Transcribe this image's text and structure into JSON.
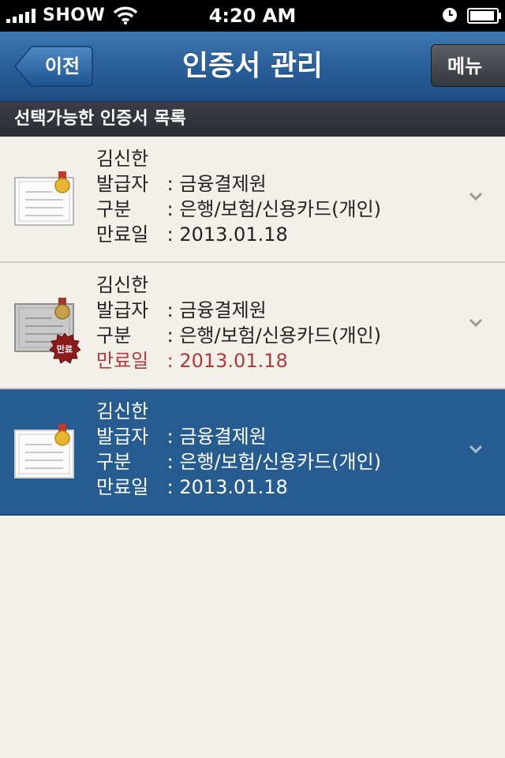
{
  "status_bar": {
    "carrier": "SHOW",
    "time": "4:20 AM"
  },
  "nav": {
    "back_label": "이전",
    "title": "인증서 관리",
    "menu_label": "메뉴"
  },
  "section": {
    "title": "선택가능한 인증서 목록"
  },
  "colors": {
    "nav_blue": "#2a5f98",
    "selected_row": "#275c91",
    "expired_text": "#b03a3a",
    "list_bg": "#f3efe9"
  },
  "certificates": [
    {
      "name": "김신한",
      "issuer_label": "발급자",
      "issuer": "금융결제원",
      "type_label": "구분",
      "type": "은행/보험/신용카드(개인)",
      "expiry_label": "만료일",
      "expiry": "2013.01.18",
      "icon": "certificate-icon",
      "expired": false,
      "selected": false
    },
    {
      "name": "김신한",
      "issuer_label": "발급자",
      "issuer": "금융결제원",
      "type_label": "구분",
      "type": "은행/보험/신용카드(개인)",
      "expiry_label": "만료일",
      "expiry": "2013.01.18",
      "icon": "certificate-expired-icon",
      "badge": "만료",
      "expired": true,
      "selected": false
    },
    {
      "name": "김신한",
      "issuer_label": "발급자",
      "issuer": "금융결제원",
      "type_label": "구분",
      "type": "은행/보험/신용카드(개인)",
      "expiry_label": "만료일",
      "expiry": "2013.01.18",
      "icon": "certificate-icon",
      "expired": false,
      "selected": true
    }
  ]
}
